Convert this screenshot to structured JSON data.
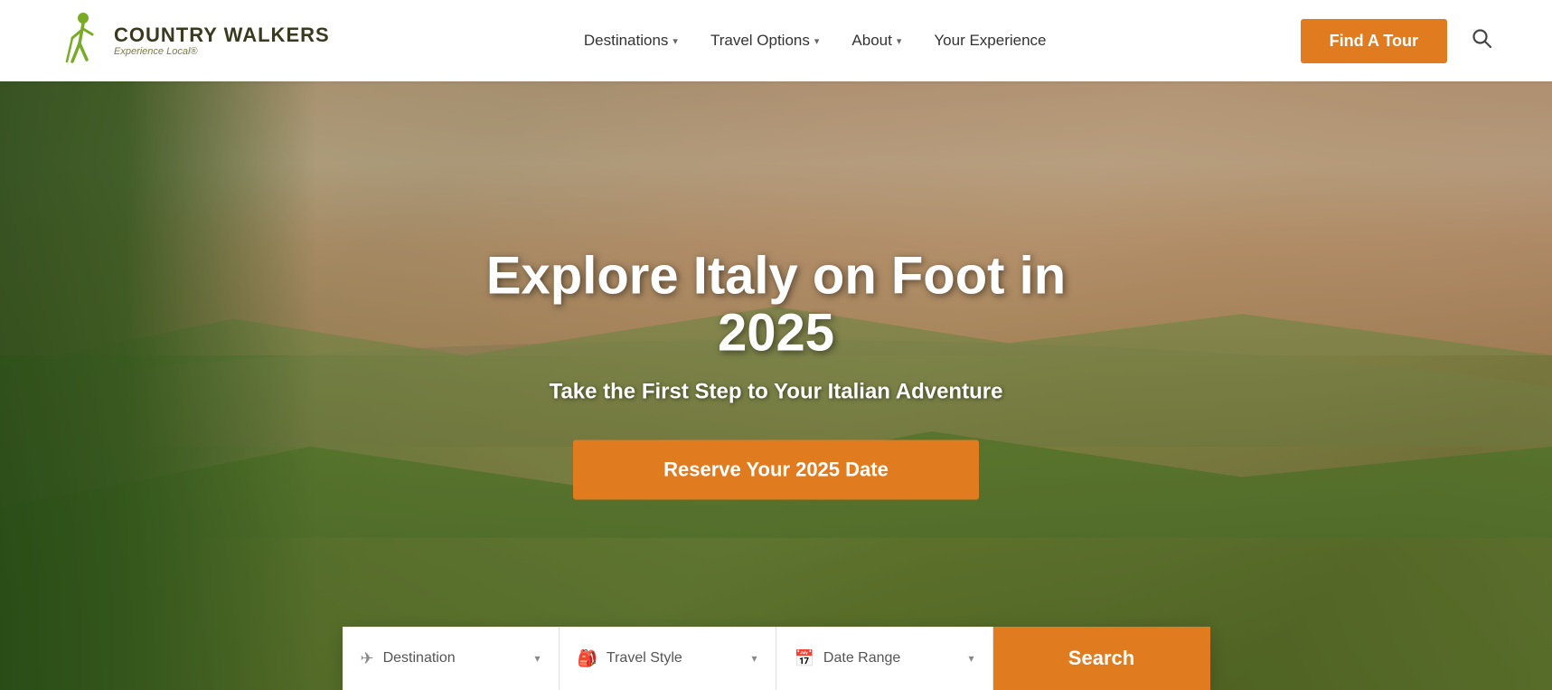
{
  "header": {
    "logo": {
      "name": "Country Walkers",
      "tagline": "Experience Local®"
    },
    "nav": [
      {
        "label": "Destinations",
        "hasDropdown": true
      },
      {
        "label": "Travel Options",
        "hasDropdown": true
      },
      {
        "label": "About",
        "hasDropdown": true
      },
      {
        "label": "Your Experience",
        "hasDropdown": false
      }
    ],
    "find_tour_label": "Find A Tour"
  },
  "hero": {
    "title": "Explore Italy on Foot in 2025",
    "subtitle": "Take the First Step to Your Italian Adventure",
    "cta_label": "Reserve Your 2025 Date"
  },
  "search": {
    "destination_placeholder": "Destination",
    "travel_style_placeholder": "Travel Style",
    "date_range_placeholder": "Date Range",
    "search_label": "Search"
  }
}
